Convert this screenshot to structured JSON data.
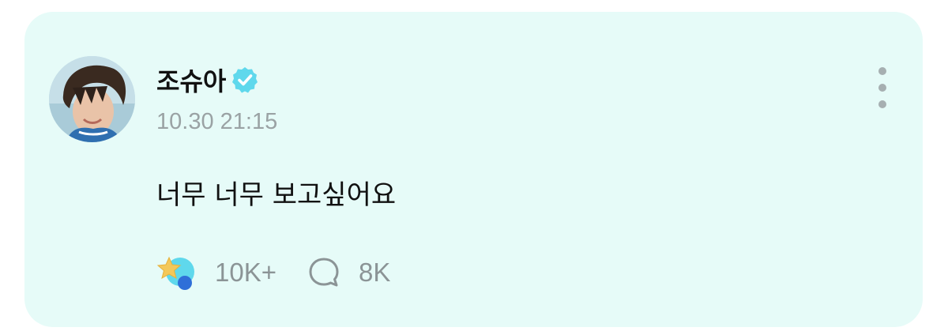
{
  "post": {
    "author_name": "조슈아",
    "verified": true,
    "timestamp": "10.30 21:15",
    "body": "너무 너무 보고싶어요"
  },
  "actions": {
    "reactions_count": "10K+",
    "comments_count": "8K"
  },
  "icons": {
    "verified": "verified-badge-icon",
    "more": "more-vertical-icon",
    "reaction": "star-reaction-icon",
    "comment": "comment-bubble-icon"
  },
  "colors": {
    "card_background": "#e6fbf8",
    "accent": "#5fd8ec",
    "muted_text": "#9aa2a4",
    "primary_text": "#111111"
  }
}
